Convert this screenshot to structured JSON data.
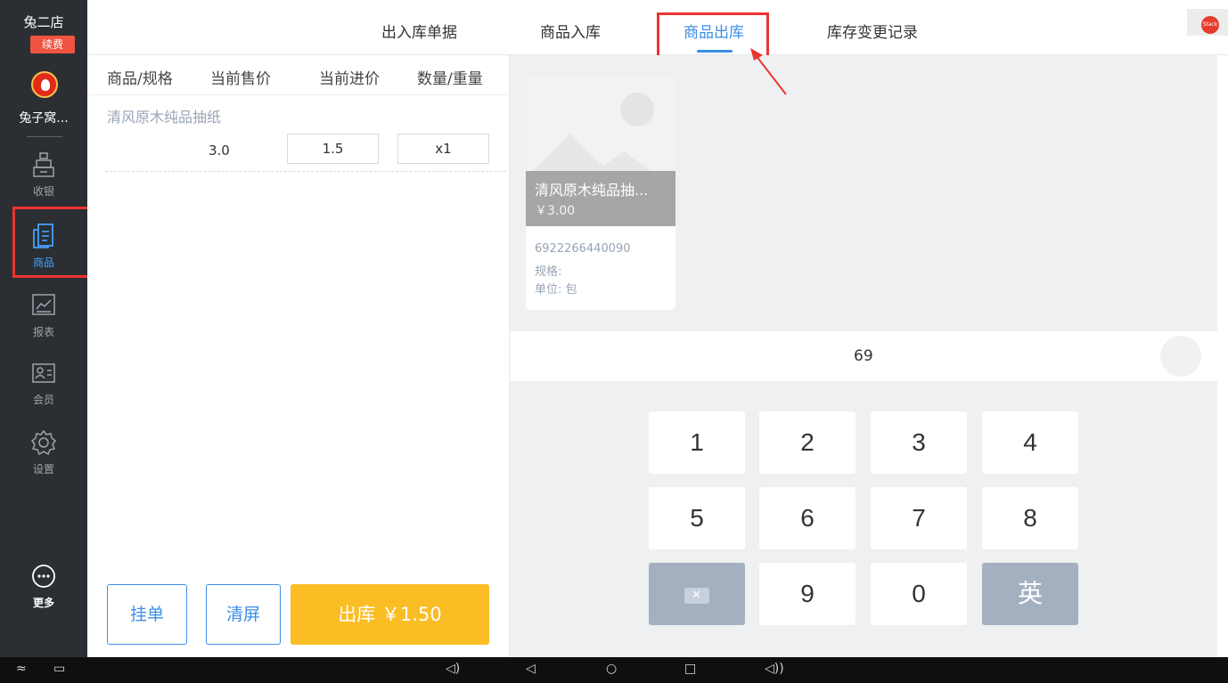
{
  "sidebar": {
    "store_name": "兔二店",
    "renew_label": "续费",
    "user_name": "兔子窝...",
    "items": [
      {
        "label": "收银",
        "icon": "cash-register-icon"
      },
      {
        "label": "商品",
        "icon": "product-icon"
      },
      {
        "label": "报表",
        "icon": "report-chart-icon"
      },
      {
        "label": "会员",
        "icon": "member-card-icon"
      },
      {
        "label": "设置",
        "icon": "gear-icon"
      }
    ],
    "more_label": "更多"
  },
  "tabs": [
    "出入库单据",
    "商品入库",
    "商品出库",
    "库存变更记录"
  ],
  "active_tab": "商品出库",
  "top_badge_text": "Stack",
  "list": {
    "headers": [
      "商品/规格",
      "当前售价",
      "当前进价",
      "数量/重量"
    ],
    "rows": [
      {
        "name": "清风原木纯品抽纸",
        "sale_price": "3.0",
        "purchase_price": "1.5",
        "quantity": "x1"
      }
    ]
  },
  "actions": {
    "hold_label": "挂单",
    "clear_label": "清屏",
    "checkout_label": "出库 ￥1.50"
  },
  "product_card": {
    "title": "清风原木纯品抽...",
    "price": "￥3.00",
    "barcode": "6922266440090",
    "spec": "规格:",
    "unit": "单位: 包"
  },
  "search": {
    "value": "69"
  },
  "keypad": {
    "rows": [
      [
        "1",
        "2",
        "3",
        "4"
      ],
      [
        "5",
        "6",
        "7",
        "8"
      ],
      [
        "backspace",
        "9",
        "0",
        "英"
      ]
    ]
  },
  "colors": {
    "accent": "#3b8ee8",
    "checkout": "#fbbd24",
    "sidebar_bg": "#2b2f33",
    "highlight": "#ee3333"
  }
}
